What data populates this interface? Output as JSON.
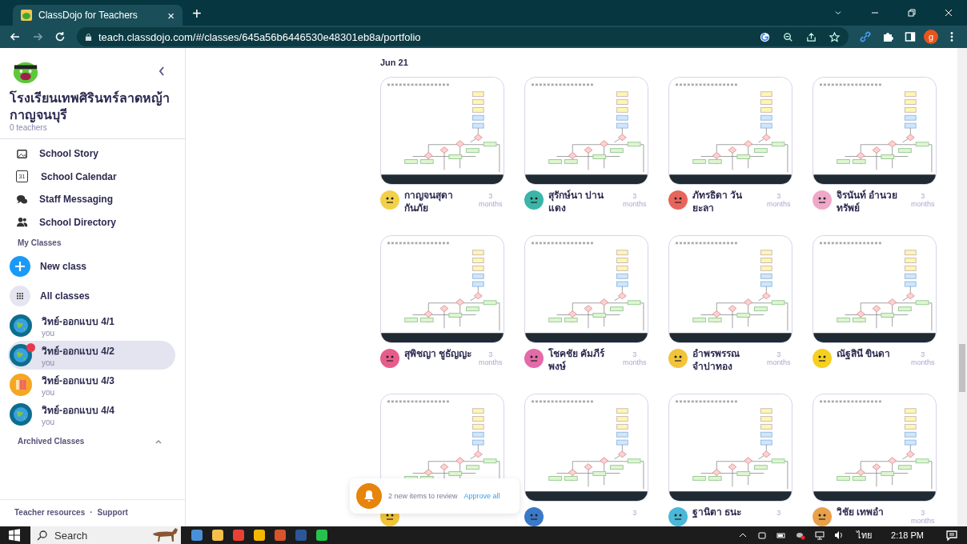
{
  "browser": {
    "tab": {
      "title": "ClassDojo for Teachers",
      "close": "×"
    },
    "new_tab": "+",
    "url": "teach.classdojo.com/#/classes/645a56b6446530e48301eb8a/portfolio",
    "profile_initial": "g"
  },
  "sidebar": {
    "school_name": "โรงเรียนเทพศิรินทร์ลาดหญ้า กาญจนบุรี",
    "teacher_count": "0 teachers",
    "nav": [
      {
        "kind": "story",
        "label": "School Story"
      },
      {
        "kind": "calendar",
        "label": "School Calendar",
        "icon_text": "31"
      },
      {
        "kind": "messaging",
        "label": "Staff Messaging"
      },
      {
        "kind": "directory",
        "label": "School Directory"
      }
    ],
    "my_classes_heading": "My Classes",
    "actions": [
      {
        "kind": "new",
        "label": "New class"
      },
      {
        "kind": "all",
        "label": "All classes"
      }
    ],
    "classes": [
      {
        "name": "วิทย์-ออกแบบ 4/1",
        "subtitle": "you",
        "kind": "globe",
        "selected": false,
        "unread": false
      },
      {
        "name": "วิทย์-ออกแบบ 4/2",
        "subtitle": "you",
        "kind": "globe",
        "selected": true,
        "unread": true
      },
      {
        "name": "วิทย์-ออกแบบ 4/3",
        "subtitle": "you",
        "kind": "books",
        "selected": false,
        "unread": false
      },
      {
        "name": "วิทย์-ออกแบบ 4/4",
        "subtitle": "you",
        "kind": "globe",
        "selected": false,
        "unread": false
      }
    ],
    "archived": {
      "label": "Archived Classes",
      "expanded": true
    },
    "footer": {
      "links": [
        "Teacher resources",
        "Support"
      ],
      "separator": "·"
    }
  },
  "portfolio": {
    "date": "Jun 21",
    "posts": [
      {
        "name": "กาญจนสุดา กันภัย",
        "time": "3 months",
        "color": "#f2d04a"
      },
      {
        "name": "สุรักษ์นา ปานแดง",
        "time": "3 months",
        "color": "#3bb5a8"
      },
      {
        "name": "ภัทรธิดา วันยะลา",
        "time": "3 months",
        "color": "#e8655c"
      },
      {
        "name": "จิรนันท์ อำนวยทรัพย์",
        "time": "3 months",
        "color": "#f0a8c8"
      },
      {
        "name": "สุพิชญา ชูธัญญะ",
        "time": "3 months",
        "color": "#e85c8c"
      },
      {
        "name": "โชคชัย คัมภีร์พงษ์",
        "time": "3 months",
        "color": "#e46aa8"
      },
      {
        "name": "อำพรพรรณ จำปาทอง",
        "time": "3 months",
        "color": "#f2c43a"
      },
      {
        "name": "ณัฐสินี ขินดา",
        "time": "3 months",
        "color": "#f5d020"
      },
      {
        "color": "#f2c43a"
      },
      {
        "time": "3",
        "color": "#3a78c8"
      },
      {
        "name": "ฐานิตา ธนะ",
        "time": "3",
        "color": "#4ab8d8"
      },
      {
        "name": "วิชัย เทพอำ",
        "time": "3 months",
        "color": "#e8a04a"
      }
    ]
  },
  "toast": {
    "message": "2 new items to review",
    "action": "Approve all"
  },
  "taskbar": {
    "search": "Search",
    "apps": [
      {
        "color": "#4a90d9"
      },
      {
        "color": "#f5c04a"
      },
      {
        "color": "#e94235"
      },
      {
        "color": "#f5b800"
      },
      {
        "color": "#d9542b"
      },
      {
        "color": "#2b5797"
      },
      {
        "color": "#27c24c"
      }
    ],
    "language": "ไทย",
    "time": "2:18 PM"
  }
}
